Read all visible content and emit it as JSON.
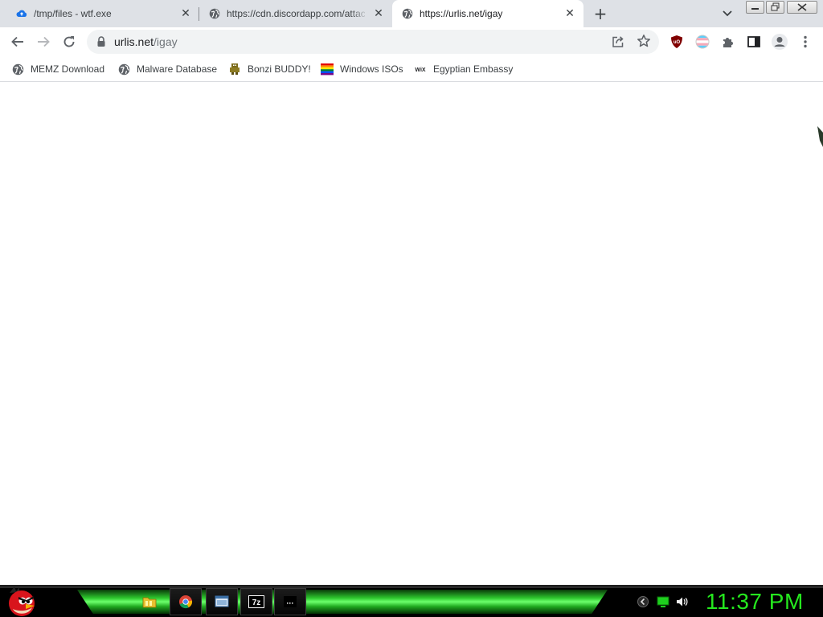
{
  "browser": {
    "tabs": [
      {
        "title": "/tmp/files - wtf.exe",
        "favicon": "cloud-upload-icon",
        "active": false
      },
      {
        "title": "https://cdn.discordapp.com/attachments",
        "favicon": "globe-icon",
        "active": false
      },
      {
        "title": "https://urlis.net/igay",
        "favicon": "globe-icon",
        "active": true
      }
    ],
    "new_tab_label": "+",
    "close_glyph": "✕",
    "address": {
      "host": "urlis.net",
      "path": "/igay"
    },
    "bookmarks": [
      {
        "label": "MEMZ Download",
        "icon": "globe-icon"
      },
      {
        "label": "Malware Database",
        "icon": "globe-icon"
      },
      {
        "label": "Bonzi BUDDY!",
        "icon": "bonzi-icon"
      },
      {
        "label": "Windows ISOs",
        "icon": "rainbow-flag-icon"
      },
      {
        "label": "Egyptian Embassy",
        "icon": "wix-icon"
      }
    ],
    "extensions": [
      "ublock-icon",
      "flag-extension-icon",
      "puzzle-icon"
    ]
  },
  "taskbar": {
    "clock": "11:37 PM",
    "pinned": [
      "folder-icon",
      "chrome-icon",
      "window-icon",
      "7zip-icon",
      "terminal-icon"
    ],
    "tray": [
      "back-arrow-icon",
      "monitor-icon",
      "speaker-icon"
    ],
    "accent_color": "#25e81e"
  },
  "wix_label": "WiX",
  "sevenzip_label": "7z"
}
